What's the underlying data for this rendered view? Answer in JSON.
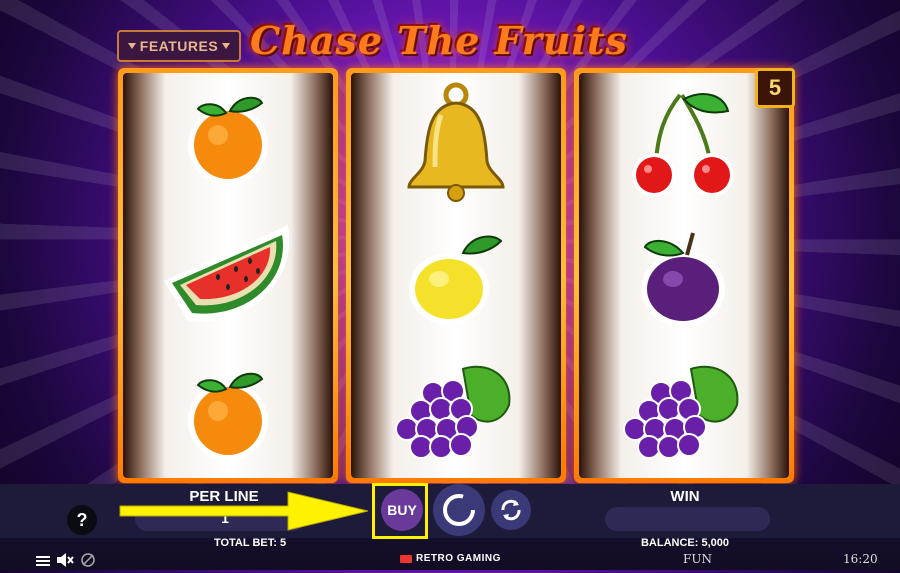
{
  "game": {
    "title": "Chase The Fruits",
    "features_label": "FEATURES",
    "counter_value": "5"
  },
  "reels": [
    {
      "symbols": [
        "orange",
        "watermelon",
        "orange"
      ]
    },
    {
      "symbols": [
        "bell",
        "lemon",
        "grapes"
      ]
    },
    {
      "symbols": [
        "cherries",
        "plum",
        "grapes"
      ]
    }
  ],
  "controls": {
    "help_label": "?",
    "per_line_label": "PER LINE",
    "per_line_value": "1",
    "win_label": "WIN",
    "win_value": "",
    "buy_label": "BUY",
    "total_bet": "TOTAL BET: 5",
    "balance": "BALANCE: 5,000"
  },
  "footer": {
    "provider": "RETRO GAMING",
    "mode": "FUN",
    "time": "16:20"
  },
  "colors": {
    "highlight": "#fff200",
    "reel_frame": "#ffae2a",
    "title": "#ff7a1a"
  }
}
